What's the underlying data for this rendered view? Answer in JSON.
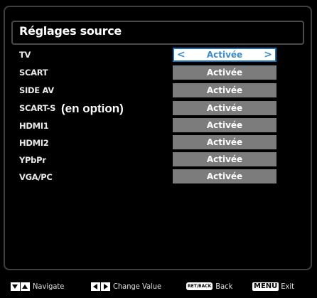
{
  "title": "Réglages source",
  "optional_note": "(en option)",
  "rows": [
    {
      "label": "TV",
      "value": "Activée",
      "selected": true
    },
    {
      "label": "SCART",
      "value": "Activée"
    },
    {
      "label": "SIDE AV",
      "value": "Activée"
    },
    {
      "label": "SCART-S",
      "value": "Activée"
    },
    {
      "label": "HDMI1",
      "value": "Activée"
    },
    {
      "label": "HDMI2",
      "value": "Activée"
    },
    {
      "label": "YPbPr",
      "value": "Activée"
    },
    {
      "label": "VGA/PC",
      "value": "Activée"
    }
  ],
  "footer": {
    "navigate": "Navigate",
    "change_value": "Change Value",
    "retback_key": "RET/BACK",
    "back": "Back",
    "menu_key": "MENU",
    "exit": "Exit"
  },
  "colors": {
    "selected_text": "#3d8bc8",
    "value_bg": "#7c7c7c",
    "selected_border": "#1d6fb3"
  }
}
